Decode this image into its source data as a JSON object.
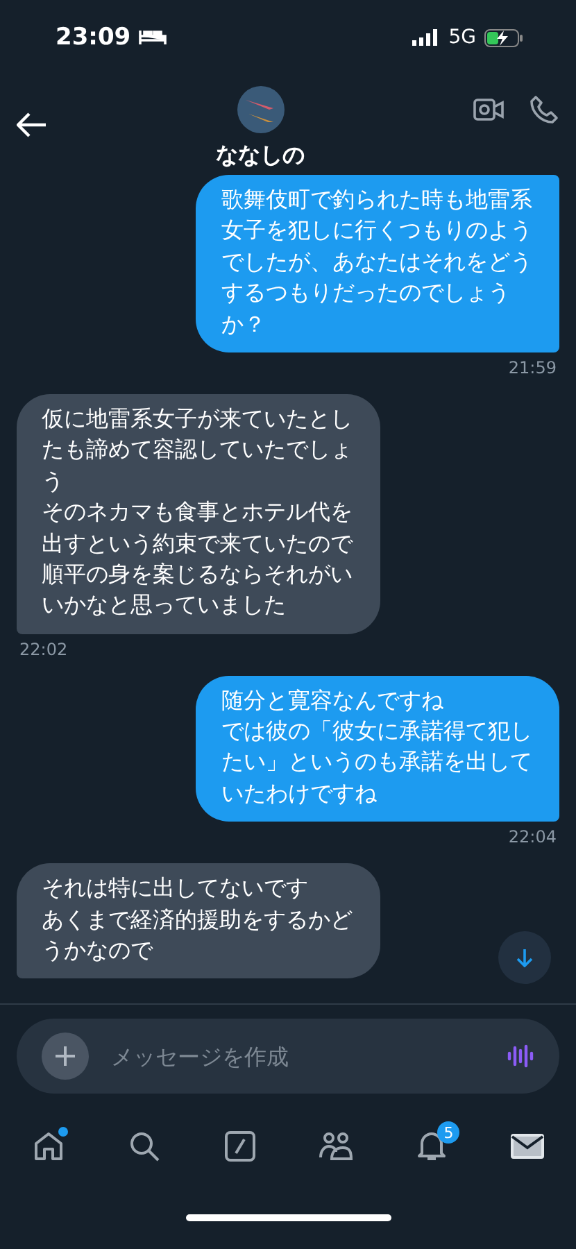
{
  "status_bar": {
    "time": "23:09",
    "network": "5G"
  },
  "header": {
    "name": "ななしの"
  },
  "messages": [
    {
      "kind": "sent",
      "lines": [
        "歌舞伎町で釣られた時も地雷系女子を犯しに行くつもりのようでしたが、あなたはそれをどうするつもりだったのでしょうか？"
      ],
      "time": "21:59"
    },
    {
      "kind": "received",
      "lines": [
        "仮に地雷系女子が来ていたとしたも諦めて容認していたでしょう",
        "そのネカマも食事とホテル代を出すという約束で来ていたので順平の身を案じるならそれがいいかなと思っていました"
      ],
      "time": "22:02"
    },
    {
      "kind": "sent",
      "lines": [
        "随分と寛容なんですね",
        "では彼の「彼女に承諾得て犯したい」というのも承諾を出していたわけですね"
      ],
      "time": "22:04"
    },
    {
      "kind": "received",
      "lines": [
        "それは特に出してないです",
        "あくまで経済的援助をするかどうかなので"
      ]
    }
  ],
  "composer": {
    "placeholder": "メッセージを作成"
  },
  "tabs": [
    {
      "kind": "home",
      "selected": false,
      "dot": true
    },
    {
      "kind": "search",
      "selected": false,
      "dot": false
    },
    {
      "kind": "grok",
      "selected": false,
      "dot": false
    },
    {
      "kind": "communities",
      "selected": false,
      "dot": false
    },
    {
      "kind": "notifications",
      "selected": false,
      "dot": false,
      "badge": "5"
    },
    {
      "kind": "messages",
      "selected": true,
      "dot": false
    }
  ]
}
